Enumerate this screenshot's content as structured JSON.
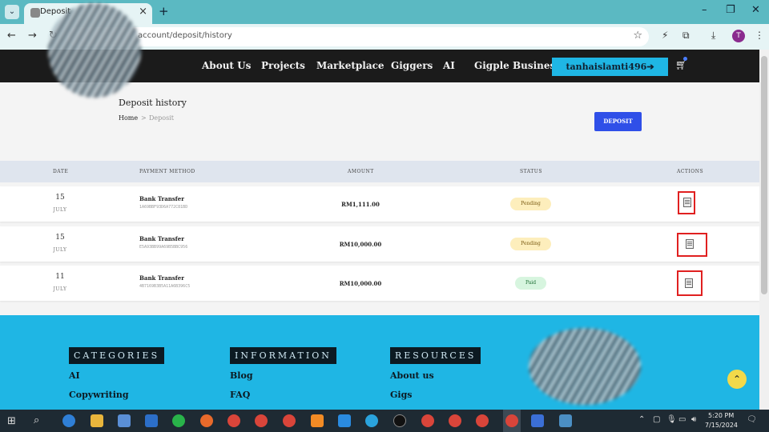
{
  "browser": {
    "tab_title": "Deposit",
    "url": "account/deposit/history",
    "profile_initial": "T"
  },
  "site_nav": {
    "links": [
      "About Us",
      "Projects",
      "Marketplace",
      "Giggers",
      "AI",
      "Gigple Business"
    ],
    "user_button": "tanhaislamti496➔"
  },
  "page": {
    "title": "Deposit history",
    "breadcrumb_home": "Home",
    "breadcrumb_separator": ">",
    "breadcrumb_current": "Deposit",
    "deposit_button": "DEPOSIT"
  },
  "table": {
    "headers": [
      "DATE",
      "PAYMENT METHOD",
      "AMOUNT",
      "STATUS",
      "ACTIONS"
    ],
    "rows": [
      {
        "day": "15",
        "month": "JULY",
        "method": "Bank Transfer",
        "reference": "1A69BBF93D6A772C81BD",
        "amount": "RM1,111.00",
        "status": "Pending"
      },
      {
        "day": "15",
        "month": "JULY",
        "method": "Bank Transfer",
        "reference": "E5A93BB99A69B5BBC956",
        "amount": "RM10,000.00",
        "status": "Pending"
      },
      {
        "day": "11",
        "month": "JULY",
        "method": "Bank Transfer",
        "reference": "4B7169B3B5A11A6B396C5",
        "amount": "RM10,000.00",
        "status": "Paid"
      }
    ]
  },
  "footer": {
    "columns": [
      {
        "heading": "CATEGORIES",
        "links": [
          "AI",
          "Copywriting"
        ]
      },
      {
        "heading": "INFORMATION",
        "links": [
          "Blog",
          "FAQ"
        ]
      },
      {
        "heading": "RESOURCES",
        "links": [
          "About us",
          "Gigs"
        ]
      }
    ]
  },
  "taskbar": {
    "time": "5:20 PM",
    "date": "7/15/2024"
  },
  "colors": {
    "nav_bg": "#1b1b1b",
    "accent_cyan": "#1fb6e4",
    "deposit_blue": "#2f4fe8",
    "pending_bg": "#fdeebc",
    "paid_bg": "#d7f5df",
    "highlight_red": "#e02020"
  }
}
